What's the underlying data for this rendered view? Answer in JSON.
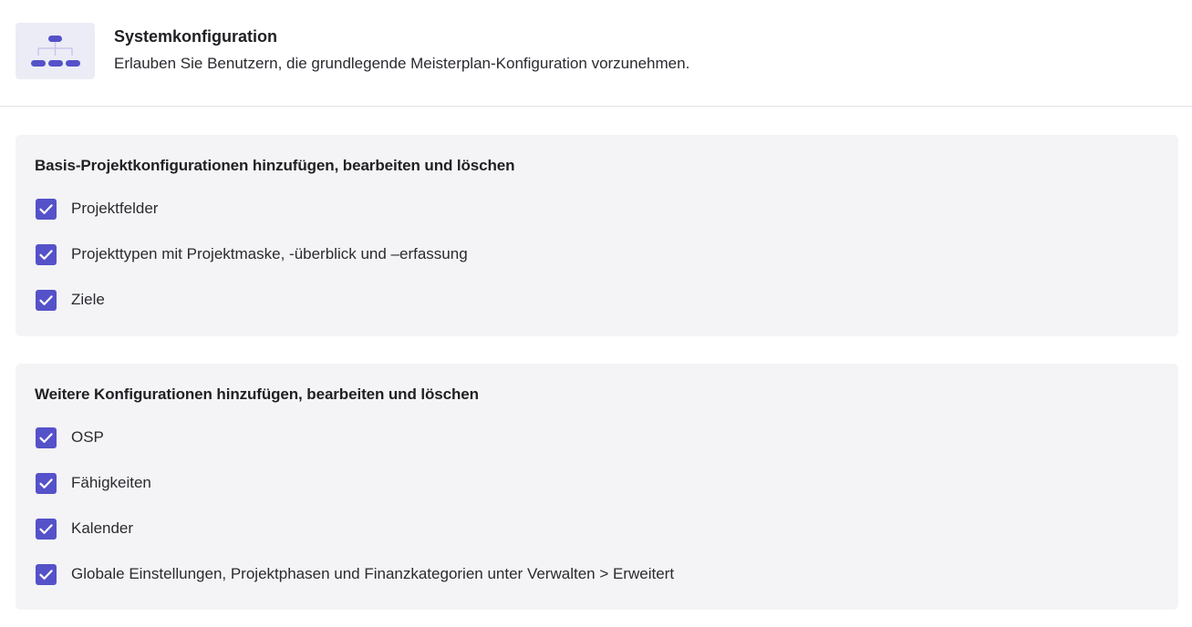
{
  "header": {
    "icon": "sitemap-icon",
    "title": "Systemkonfiguration",
    "description": "Erlauben Sie Benutzern, die grundlegende Meisterplan-Konfiguration vorzunehmen."
  },
  "sections": [
    {
      "title": "Basis-Projektkonfigurationen hinzufügen, bearbeiten und löschen",
      "options": [
        {
          "label": "Projektfelder",
          "checked": true
        },
        {
          "label": "Projekttypen mit Projektmaske, -überblick und –erfassung",
          "checked": true
        },
        {
          "label": "Ziele",
          "checked": true
        }
      ]
    },
    {
      "title": "Weitere Konfigurationen hinzufügen, bearbeiten und löschen",
      "options": [
        {
          "label": "OSP",
          "checked": true
        },
        {
          "label": "Fähigkeiten",
          "checked": true
        },
        {
          "label": "Kalender",
          "checked": true
        },
        {
          "label": "Globale Einstellungen, Projektphasen und Finanzkategorien unter Verwalten > Erweitert",
          "checked": true
        }
      ]
    }
  ],
  "colors": {
    "accent": "#5551c9",
    "section_background": "#f4f4f6",
    "icon_background": "#ececf6"
  }
}
